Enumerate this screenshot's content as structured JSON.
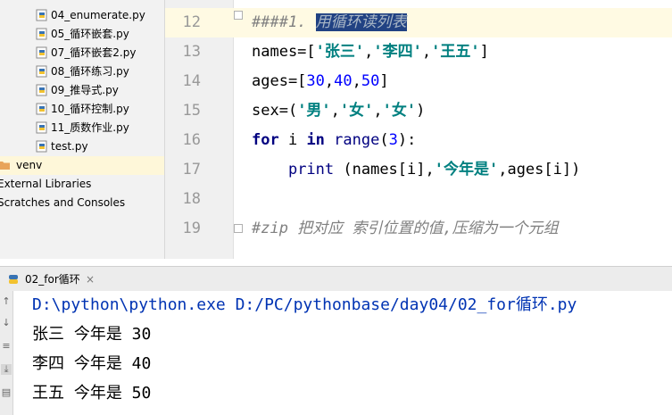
{
  "project_tree": {
    "items": [
      {
        "label": "04_enumerate.py",
        "type": "python-file"
      },
      {
        "label": "05_循环嵌套.py",
        "type": "python-file"
      },
      {
        "label": "07_循环嵌套2.py",
        "type": "python-file"
      },
      {
        "label": "08_循环练习.py",
        "type": "python-file"
      },
      {
        "label": "09_推导式.py",
        "type": "python-file"
      },
      {
        "label": "10_循环控制.py",
        "type": "python-file"
      },
      {
        "label": "11_质数作业.py",
        "type": "python-file"
      },
      {
        "label": "test.py",
        "type": "python-file"
      },
      {
        "label": "venv",
        "type": "folder"
      },
      {
        "label": "External Libraries",
        "type": "libraries"
      },
      {
        "label": "Scratches and Consoles",
        "type": "scratches"
      }
    ]
  },
  "editor": {
    "lines": [
      {
        "number": "12",
        "prefix": "####1. ",
        "selected": "用循环读列表"
      },
      {
        "number": "13",
        "p1": "names=[",
        "s1": "'张三'",
        "c1": ",",
        "s2": "'李四'",
        "c2": ",",
        "s3": "'王五'",
        "p2": "]"
      },
      {
        "number": "14",
        "p1": "ages=[",
        "n1": "30",
        "c1": ",",
        "n2": "40",
        "c2": ",",
        "n3": "50",
        "p2": "]"
      },
      {
        "number": "15",
        "p1": "sex=(",
        "s1": "'男'",
        "c1": ",",
        "s2": "'女'",
        "c2": ",",
        "s3": "'女'",
        "p2": ")"
      },
      {
        "number": "16",
        "k1": "for",
        "t1": " i ",
        "k2": "in",
        "t2": " ",
        "b1": "range",
        "p1": "(",
        "n1": "3",
        "p2": "):"
      },
      {
        "number": "17",
        "indent": "    ",
        "b1": "print",
        "t1": " (names[i],",
        "s1": "'今年是'",
        "t2": ",ages[i])"
      },
      {
        "number": "18"
      },
      {
        "number": "19",
        "comment": "#zip 把对应 索引位置的值,压缩为一个元组"
      }
    ]
  },
  "run_panel": {
    "tab_label": "02_for循环",
    "close_label": "×",
    "output": [
      {
        "text": "D:\\python\\python.exe D:/PC/pythonbase/day04/02_for循环.py",
        "kind": "cmd"
      },
      {
        "text": "张三 今年是 30",
        "kind": "out"
      },
      {
        "text": "李四 今年是 40",
        "kind": "out"
      },
      {
        "text": "王五 今年是 50",
        "kind": "out"
      }
    ]
  },
  "colors": {
    "keyword": "#000080",
    "string": "#008080",
    "number": "#0000ff",
    "comment": "#808080",
    "selection": "#214283",
    "cmd": "#0033b3"
  }
}
